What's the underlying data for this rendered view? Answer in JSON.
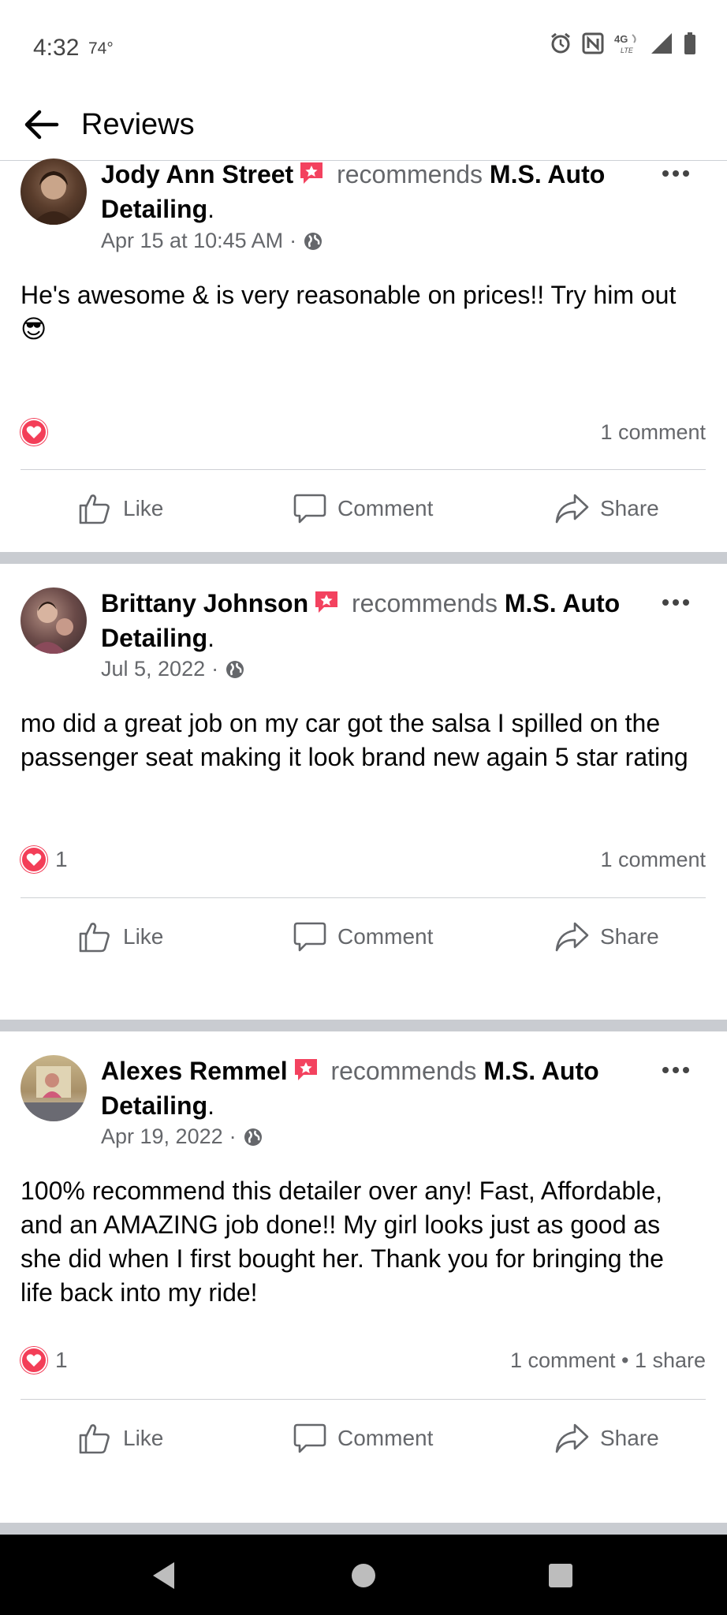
{
  "status_bar": {
    "time": "4:32",
    "temperature": "74°",
    "icons": [
      "alarm-icon",
      "nfc-icon",
      "4g-lte-icon",
      "signal-icon",
      "battery-icon"
    ],
    "network_label": "4G"
  },
  "header": {
    "title": "Reviews",
    "back_icon": "arrow-left-icon"
  },
  "posts": [
    {
      "author": "Jody Ann Street",
      "recommends_text": "recommends",
      "page_name": "M.S. Auto Detailing",
      "date": "Apr 15 at 10:45 AM",
      "body": "He's awesome & is very reasonable on prices!! Try him out",
      "emoji": "😎",
      "reaction_count": "",
      "counts": "1 comment"
    },
    {
      "author": "Brittany Johnson",
      "recommends_text": "recommends",
      "page_name": "M.S. Auto Detailing",
      "date": "Jul 5, 2022",
      "body": "mo did a great job on my car got the salsa I spilled on the passenger seat making it look brand new again 5 star rating",
      "emoji": "",
      "reaction_count": "1",
      "counts": "1 comment"
    },
    {
      "author": "Alexes Remmel",
      "recommends_text": "recommends",
      "page_name": "M.S. Auto Detailing",
      "date": "Apr 19, 2022",
      "body": "100% recommend this detailer over any! Fast, Affordable, and an AMAZING job done!! My girl looks just as good as she did when I first bought her. Thank you for bringing the life back into my ride!",
      "emoji": "",
      "reaction_count": "1",
      "counts": "1 comment • 1 share"
    }
  ],
  "actions": {
    "like": "Like",
    "comment": "Comment",
    "share": "Share"
  },
  "colors": {
    "love": "#f33e58",
    "recommend_badge": "#f3425f",
    "secondary_text": "#65676b",
    "separator": "#c9ccd1"
  },
  "nav_bar": {
    "icons": [
      "back-triangle-icon",
      "home-circle-icon",
      "recents-square-icon"
    ]
  }
}
